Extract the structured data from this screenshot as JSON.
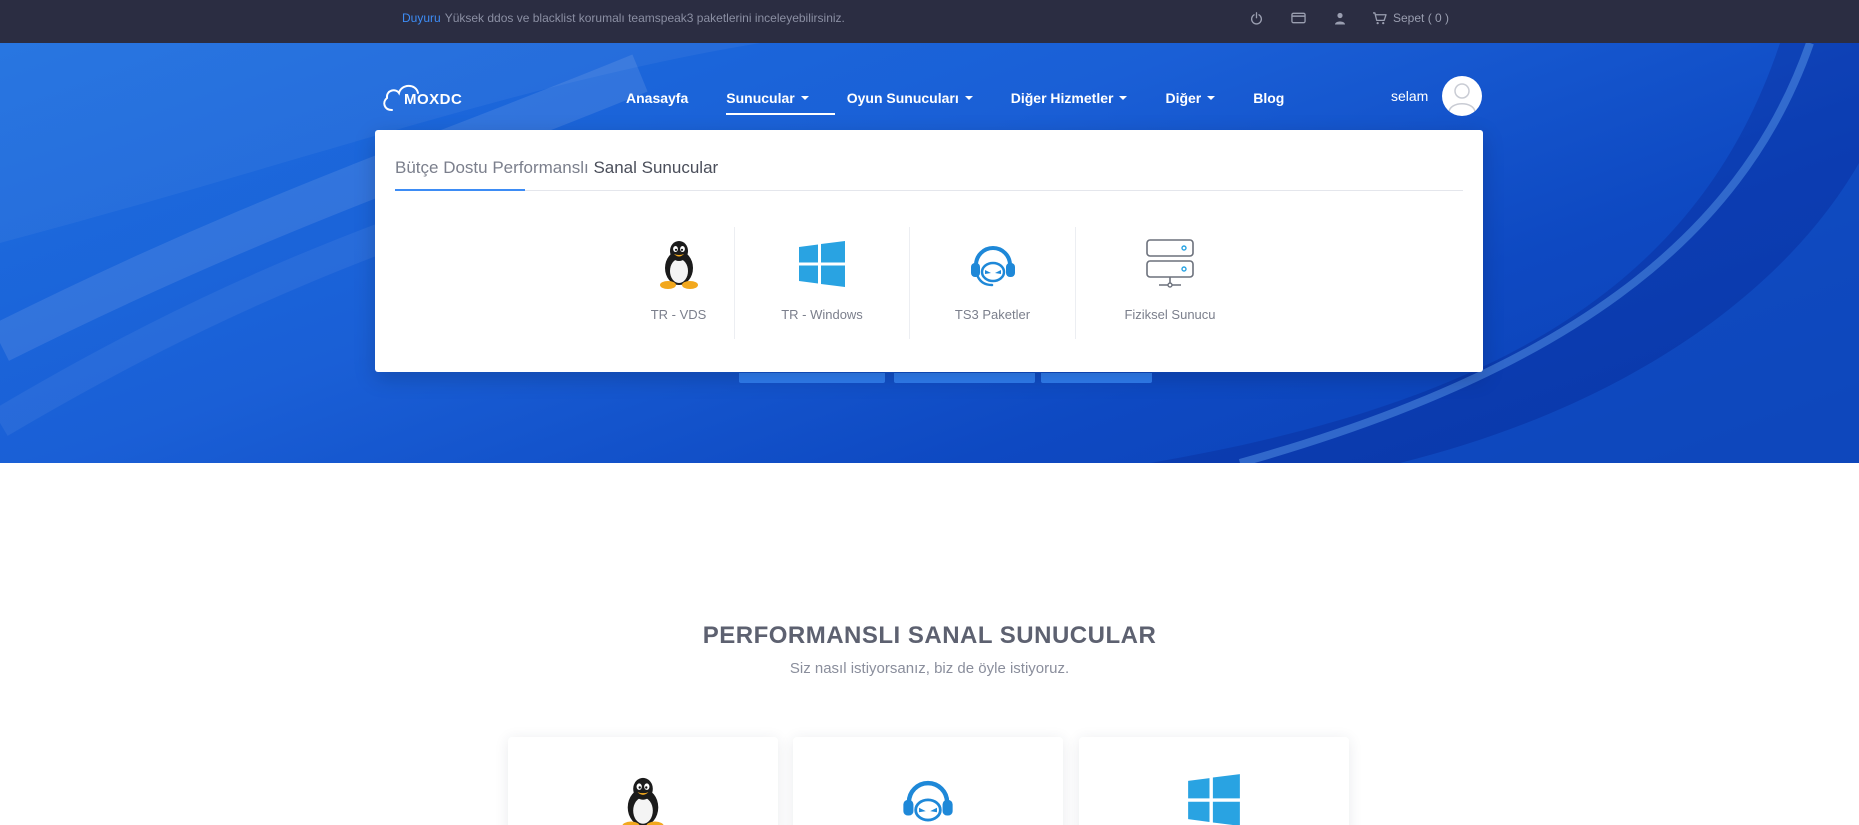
{
  "announcement": {
    "tag": "Duyuru",
    "text": "Yüksek ddos ve blacklist korumalı teamspeak3 paketlerini inceleyebilirsiniz."
  },
  "top_actions": {
    "icons": [
      "power-icon",
      "credit-card-icon",
      "user-icon"
    ],
    "cart_label": "Sepet ( 0 )"
  },
  "brand": {
    "name": "MOXDC"
  },
  "nav": {
    "items": [
      {
        "label": "Anasayfa",
        "dropdown": false,
        "active": false
      },
      {
        "label": "Sunucular",
        "dropdown": true,
        "active": true
      },
      {
        "label": "Oyun Sunucuları",
        "dropdown": true,
        "active": false
      },
      {
        "label": "Diğer Hizmetler",
        "dropdown": true,
        "active": false
      },
      {
        "label": "Diğer",
        "dropdown": true,
        "active": false
      },
      {
        "label": "Blog",
        "dropdown": false,
        "active": false
      }
    ]
  },
  "user": {
    "name": "selam"
  },
  "mega_menu": {
    "title_light": "Bütçe Dostu Performanslı",
    "title_strong": "Sanal Sunucular",
    "items": [
      {
        "label": "TR - VDS",
        "icon": "linux-tux-icon"
      },
      {
        "label": "TR - Windows",
        "icon": "windows-icon"
      },
      {
        "label": "TS3 Paketler",
        "icon": "headset-icon"
      },
      {
        "label": "Fiziksel Sunucu",
        "icon": "server-icon"
      }
    ]
  },
  "section": {
    "title": "PERFORMANSLI SANAL SUNUCULAR",
    "subtitle": "Siz nasıl istiyorsanız, biz de öyle istiyoruz."
  },
  "cards": [
    {
      "icon": "linux-tux-icon"
    },
    {
      "icon": "headset-icon"
    },
    {
      "icon": "windows-icon"
    }
  ],
  "colors": {
    "topbar": "#2b2d42",
    "accent": "#3d8cf5",
    "hero_start": "#1d6fe0",
    "hero_end": "#0b3fb3"
  }
}
